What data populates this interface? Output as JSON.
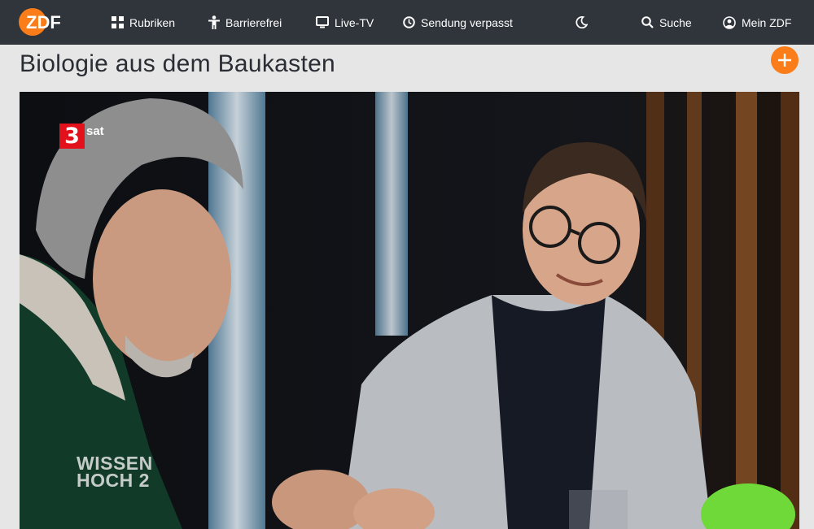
{
  "nav": {
    "logo_text": "ZDF",
    "items": [
      {
        "label": "Rubriken",
        "icon": "grid-icon"
      },
      {
        "label": "Barrierefrei",
        "icon": "accessibility-icon"
      },
      {
        "label": "Live-TV",
        "icon": "tv-icon"
      },
      {
        "label": "Sendung verpasst",
        "icon": "clock-icon"
      },
      {
        "label": "",
        "icon": "moon-icon"
      },
      {
        "label": "Suche",
        "icon": "search-icon"
      },
      {
        "label": "Mein ZDF",
        "icon": "user-icon"
      }
    ]
  },
  "page": {
    "title": "Biologie aus dem Baukasten"
  },
  "player": {
    "channel_number": "3",
    "channel_name": "sat",
    "show_logo_line1": "WISSEN",
    "show_logo_line2": "HOCH 2"
  },
  "colors": {
    "header_bg": "#30353b",
    "accent": "#fa7d19",
    "page_bg": "#e6e6e6"
  }
}
